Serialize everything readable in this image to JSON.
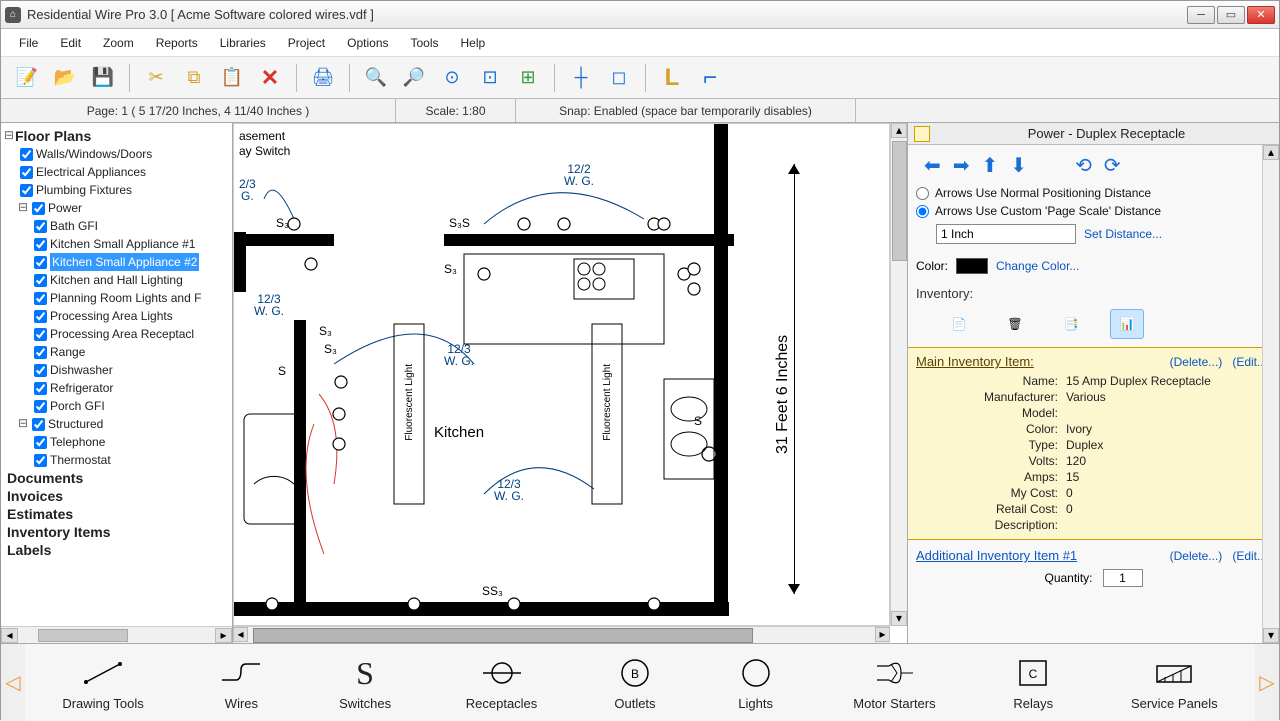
{
  "window": {
    "title": "Residential Wire Pro 3.0  [ Acme Software colored wires.vdf ]"
  },
  "menu": [
    "File",
    "Edit",
    "Zoom",
    "Reports",
    "Libraries",
    "Project",
    "Options",
    "Tools",
    "Help"
  ],
  "status": {
    "page": "Page: 1   ( 5 17/20 Inches, 4 11/40 Inches )",
    "scale": "Scale: 1:80",
    "snap": "Snap: Enabled  (space bar temporarily disables)"
  },
  "tree": {
    "root": "Floor Plans",
    "layers": [
      {
        "label": "Walls/Windows/Doors",
        "lvl": 1,
        "chk": true
      },
      {
        "label": "Electrical Appliances",
        "lvl": 1,
        "chk": true
      },
      {
        "label": "Plumbing Fixtures",
        "lvl": 1,
        "chk": true
      }
    ],
    "power_label": "Power",
    "power": [
      {
        "label": "Bath GFI"
      },
      {
        "label": "Kitchen Small Appliance #1"
      },
      {
        "label": "Kitchen Small Appliance #2",
        "sel": true
      },
      {
        "label": "Kitchen and Hall Lighting"
      },
      {
        "label": "Planning Room Lights and F"
      },
      {
        "label": "Processing Area Lights"
      },
      {
        "label": "Processing Area Receptacl"
      },
      {
        "label": "Range"
      },
      {
        "label": "Dishwasher"
      },
      {
        "label": "Refrigerator"
      },
      {
        "label": "Porch GFI"
      }
    ],
    "structured_label": "Structured",
    "structured": [
      {
        "label": "Telephone"
      },
      {
        "label": "Thermostat"
      }
    ],
    "plain": [
      "Documents",
      "Invoices",
      "Estimates",
      "Inventory Items",
      "Labels"
    ]
  },
  "canvas": {
    "dim_label": "31 Feet 6 Inches",
    "room_label": "Kitchen",
    "fluor1": "Fluorescent Light",
    "fluor2": "Fluorescent Light",
    "note1": "asement",
    "note2": "ay Switch",
    "wires": [
      {
        "t": "12/2",
        "b": "W. G."
      },
      {
        "t": "2/3",
        "b": "G."
      },
      {
        "t": "12/3",
        "b": "W. G."
      },
      {
        "t": "12/3",
        "b": "W. G."
      },
      {
        "t": "12/3",
        "b": "W. G."
      }
    ],
    "s_labels": [
      "S₃",
      "S₃S",
      "S₃",
      "S₃",
      "S",
      "S",
      "SS₃",
      "S₃"
    ]
  },
  "right": {
    "title": "Power - Duplex Receptacle",
    "radio1": "Arrows Use Normal Positioning Distance",
    "radio2": "Arrows Use Custom 'Page Scale' Distance",
    "distance_value": "1 Inch",
    "set_distance": "Set Distance...",
    "color_label": "Color:",
    "change_color": "Change Color...",
    "inventory_label": "Inventory:",
    "main_head": "Main Inventory Item:",
    "delete": "(Delete...)",
    "edit": "(Edit...)",
    "kv": [
      {
        "k": "Name:",
        "v": "15 Amp Duplex Receptacle"
      },
      {
        "k": "Manufacturer:",
        "v": "Various"
      },
      {
        "k": "Model:",
        "v": ""
      },
      {
        "k": "Color:",
        "v": "Ivory"
      },
      {
        "k": "Type:",
        "v": "Duplex"
      },
      {
        "k": "Volts:",
        "v": "120"
      },
      {
        "k": "Amps:",
        "v": "15"
      },
      {
        "k": "My Cost:",
        "v": "0"
      },
      {
        "k": "Retail Cost:",
        "v": "0"
      },
      {
        "k": "Description:",
        "v": ""
      }
    ],
    "add_head": "Additional Inventory Item #1",
    "qty_label": "Quantity:",
    "qty_value": "1"
  },
  "palette": [
    {
      "label": "Drawing Tools",
      "icon": "line"
    },
    {
      "label": "Wires",
      "icon": "wire"
    },
    {
      "label": "Switches",
      "icon": "S"
    },
    {
      "label": "Receptacles",
      "icon": "recept"
    },
    {
      "label": "Outlets",
      "icon": "B"
    },
    {
      "label": "Lights",
      "icon": "circle"
    },
    {
      "label": "Motor Starters",
      "icon": "motor"
    },
    {
      "label": "Relays",
      "icon": "C"
    },
    {
      "label": "Service Panels",
      "icon": "panel"
    }
  ]
}
